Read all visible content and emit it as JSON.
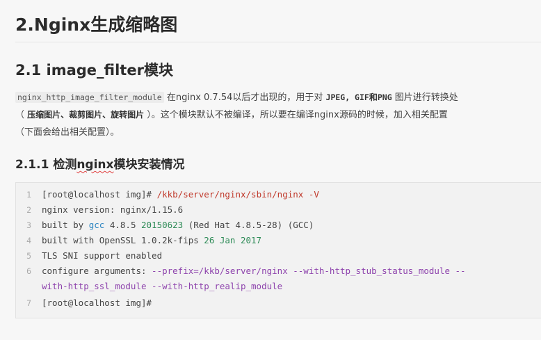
{
  "heading_main": "2.Nginx生成缩略图",
  "section": "2.1 image_filter模块",
  "paragraph": {
    "code_module": "nginx_http_image_filter_module",
    "t1": " 在nginx 0.7.54以后才出现的，用于对 ",
    "jpeg_gif": "JPEG, GIF",
    "he": "和",
    "png": "PNG",
    "t2": " 图片进行转换处",
    "t3": "（ ",
    "ops": "压缩图片、裁剪图片、旋转图片",
    "t4": " ）。这个模块默认不被编译，所以要在编译nginx源码的时候，加入相关配置",
    "t5": "（下面会给出相关配置）。"
  },
  "subsection": {
    "prefix": "2.1.1 检测",
    "highlight": "nginx",
    "suffix": "模块安装情况"
  },
  "code": {
    "line1": {
      "num": "1",
      "prompt": "[root@localhost img]# ",
      "cmd": "/kkb/server/nginx/sbin/nginx -V"
    },
    "line2": {
      "num": "2",
      "text": "nginx version: nginx/1.15.6"
    },
    "line3": {
      "num": "3",
      "a": "built by ",
      "gcc": "gcc",
      "b": " 4.8.5 ",
      "date": "20150623",
      "c": " (Red Hat 4.8.5-28) (GCC)"
    },
    "line4": {
      "num": "4",
      "a": "built with OpenSSL 1.0.2k-fips  ",
      "b": "26 Jan 2017"
    },
    "line5": {
      "num": "5",
      "text": "TLS SNI support enabled"
    },
    "line6": {
      "num": "6",
      "a": "configure arguments: ",
      "b": "--prefix=/kkb/server/nginx --with-http_stub_status_module --"
    },
    "line6b": {
      "text": "with-http_ssl_module --with-http_realip_module"
    },
    "line7": {
      "num": "7",
      "text": "[root@localhost img]#"
    }
  }
}
